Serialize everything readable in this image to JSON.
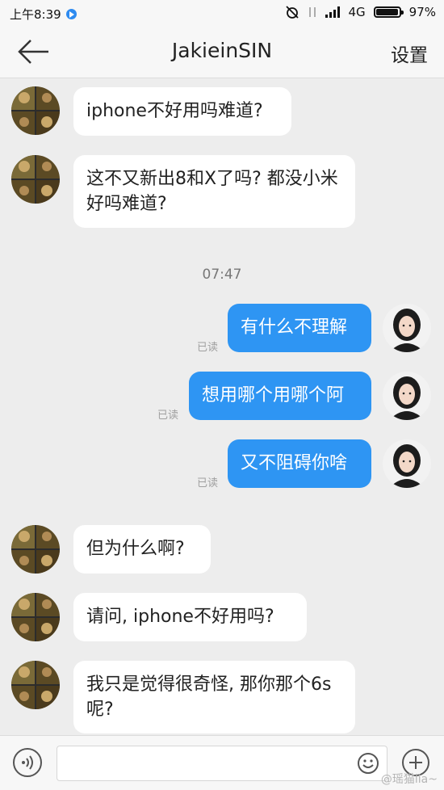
{
  "status_bar": {
    "time": "上午8:39",
    "network": "4G",
    "battery": "97%"
  },
  "header": {
    "title": "JakieinSIN",
    "settings_label": "设置",
    "back_icon": "arrow-left-icon"
  },
  "messages": [
    {
      "side": "in",
      "text": "iphone不好用吗难道?"
    },
    {
      "side": "in",
      "text": "这不又新出8和X了吗? 都没小米好吗难道?"
    },
    {
      "side": "time",
      "text": "07:47"
    },
    {
      "side": "out",
      "text": "有什么不理解",
      "status": "已读"
    },
    {
      "side": "out",
      "text": "想用哪个用哪个阿",
      "status": "已读"
    },
    {
      "side": "out",
      "text": "又不阻碍你啥",
      "status": "已读"
    },
    {
      "side": "in",
      "text": "但为什么啊?"
    },
    {
      "side": "in",
      "text": "请问, iphone不好用吗?"
    },
    {
      "side": "in",
      "text": "我只是觉得很奇怪, 那你那个6s呢?"
    }
  ],
  "input_bar": {
    "placeholder": "",
    "voice_icon": "voice-icon",
    "emoji_icon": "emoji-icon",
    "plus_icon": "plus-icon"
  },
  "watermark": "@瑶猫lia~",
  "colors": {
    "outgoing_bubble": "#2e95f3",
    "incoming_bubble": "#ffffff",
    "background": "#ededed"
  }
}
